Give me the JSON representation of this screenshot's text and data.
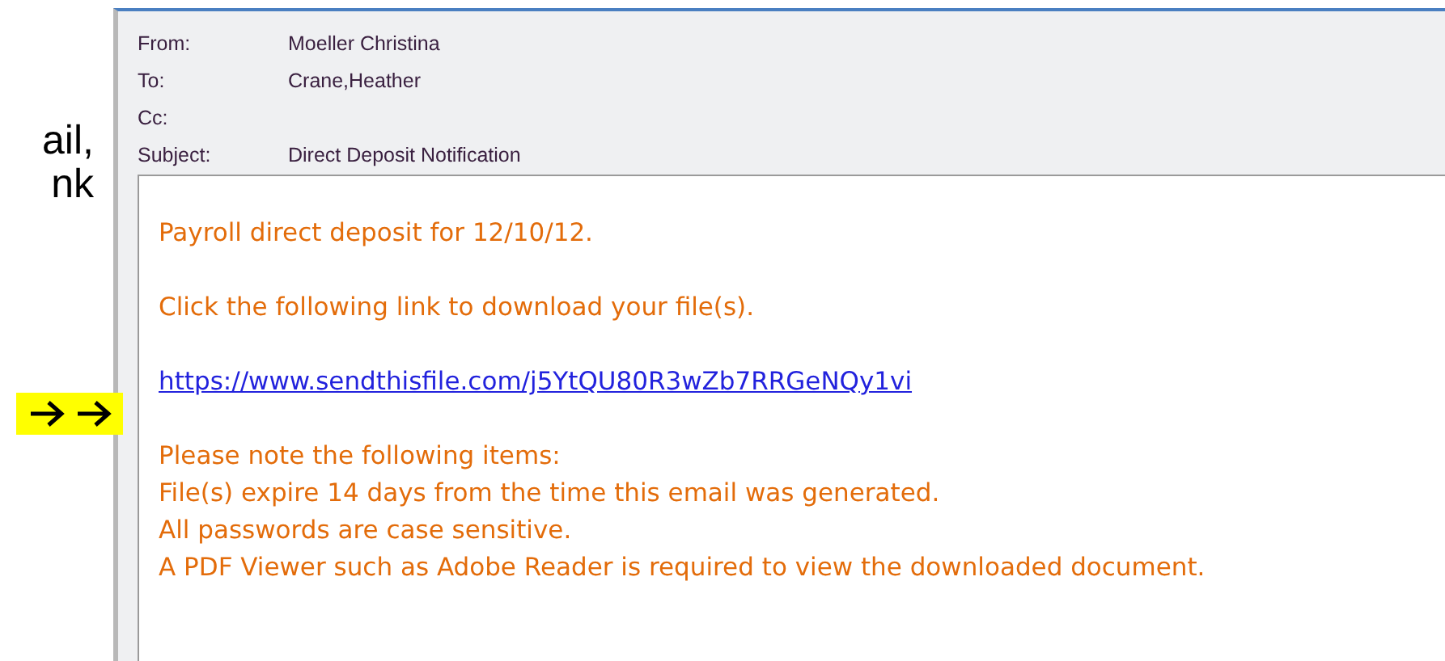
{
  "slide_text": [
    "ail,",
    "nk"
  ],
  "email": {
    "headers": [
      {
        "label": "From:",
        "value": "Moeller Christina"
      },
      {
        "label": "To:",
        "value": "Crane,Heather"
      },
      {
        "label": "Cc:"
      },
      {
        "label": "Subject:",
        "value": "Direct Deposit Notification"
      }
    ],
    "body": [
      {
        "kind": "text",
        "lines": [
          "Payroll direct deposit for 12/10/12."
        ]
      },
      {
        "kind": "text",
        "lines": [
          "Click the following link to download your file(s)."
        ]
      },
      {
        "kind": "link",
        "lines": [
          "https://www.sendthisfile.com/j5YtQU80R3wZb7RRGeNQy1vi"
        ]
      },
      {
        "kind": "text",
        "lines": [
          "Please note the following items:",
          "File(s) expire 14 days from the time this email was generated.",
          "All passwords are case sensitive.",
          "A PDF Viewer such as Adobe Reader is required to view the downloaded document."
        ]
      }
    ]
  }
}
